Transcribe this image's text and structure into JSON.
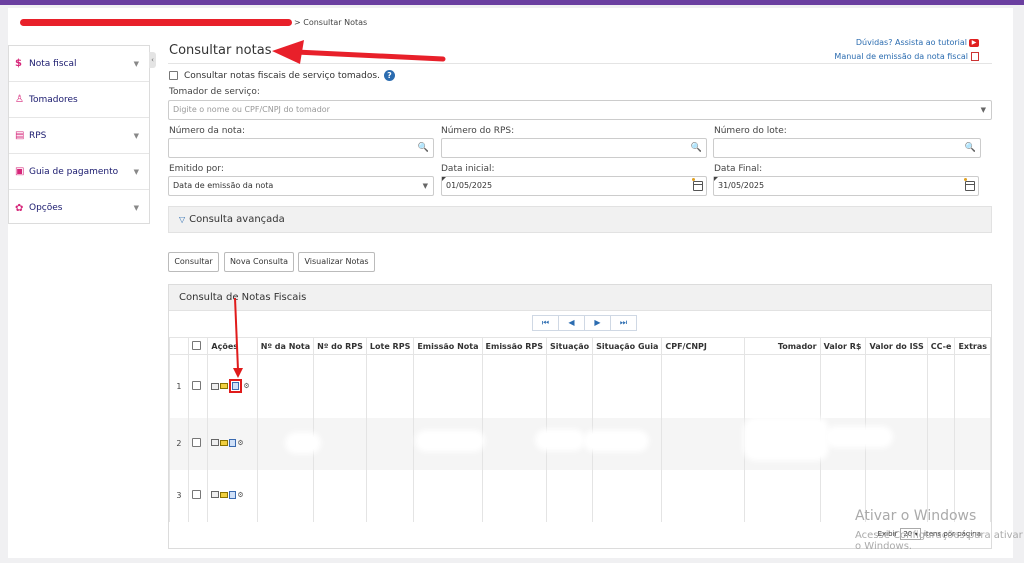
{
  "breadcrumb": {
    "current": "> Consultar Notas"
  },
  "sidebar": {
    "items": [
      {
        "label": "Nota fiscal",
        "icon": "dollar-icon",
        "caret": "▼"
      },
      {
        "label": "Tomadores",
        "icon": "user-icon",
        "caret": ""
      },
      {
        "label": "RPS",
        "icon": "document-icon",
        "caret": "▼"
      },
      {
        "label": "Guia de pagamento",
        "icon": "bill-icon",
        "caret": "▼"
      },
      {
        "label": "Opções",
        "icon": "gear-icon",
        "caret": "▼"
      }
    ],
    "collapse_glyph": "‹"
  },
  "page": {
    "title": "Consultar notas"
  },
  "help": {
    "tutorial": "Dúvidas? Assista ao tutorial",
    "manual": "Manual de emissão da nota fiscal"
  },
  "form": {
    "checkbox_label": "Consultar notas fiscais de serviço tomados.",
    "tomador_label": "Tomador de serviço:",
    "tomador_placeholder": "Digite o nome ou CPF/CNPJ do tomador",
    "numero_nota_label": "Número da nota:",
    "numero_rps_label": "Número do RPS:",
    "numero_lote_label": "Número do lote:",
    "emitido_label": "Emitido por:",
    "emitido_value": "Data de emissão da nota",
    "data_inicial_label": "Data inicial:",
    "data_inicial_value": "01/05/2025",
    "data_final_label": "Data Final:",
    "data_final_value": "31/05/2025"
  },
  "advanced": {
    "label": "Consulta avançada"
  },
  "buttons": {
    "consultar": "Consultar",
    "nova": "Nova Consulta",
    "visualizar": "Visualizar Notas"
  },
  "results": {
    "title": "Consulta de Notas Fiscais",
    "pager": [
      "⏮",
      "◀",
      "▶",
      "⏭"
    ],
    "columns": [
      "",
      "",
      "Ações",
      "Nº da Nota",
      "Nº do RPS",
      "Lote RPS",
      "Emissão Nota",
      "Emissão RPS",
      "Situação",
      "Situação Guia",
      "CPF/CNPJ",
      "Tomador",
      "Valor R$",
      "Valor do ISS",
      "CC-e",
      "Extras"
    ],
    "rows": [
      {
        "index": "1"
      },
      {
        "index": "2"
      },
      {
        "index": "3"
      }
    ],
    "footer": {
      "show": "Exibir",
      "per_page_value": "20",
      "per_page_label": "itens por página"
    }
  },
  "watermark": {
    "line1": "Ativar o Windows",
    "line2": "Acesse Configurações para ativar o Windows."
  },
  "colors": {
    "accent": "#6b3fa0",
    "brand_pink": "#d6267a",
    "link": "#2b6cb0",
    "annotation_red": "#e01b1b"
  }
}
